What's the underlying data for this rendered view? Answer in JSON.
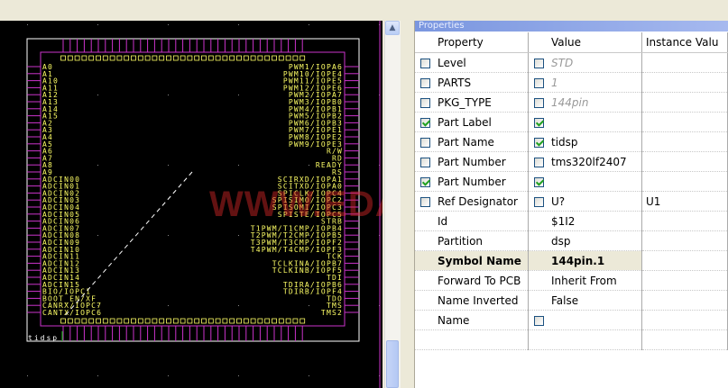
{
  "schematic": {
    "colors": {
      "background": "#000000",
      "border": "#ffffff",
      "body": "#cc33cc",
      "pin": "#cc33cc",
      "label": "#ffff66",
      "watermark": "#dc2828"
    },
    "part_label": "tidsp",
    "watermark": "WWW.EDA365.COM",
    "left_pins": [
      "A0",
      "A1",
      "A10",
      "A11",
      "A12",
      "A13",
      "A14",
      "A15",
      "A2",
      "A3",
      "A4",
      "A5",
      "A6",
      "A7",
      "A8",
      "A9",
      "ADCIN00",
      "ADCIN01",
      "ADCIN02",
      "ADCIN03",
      "ADCIN04",
      "ADCIN05",
      "ADCIN06",
      "ADCIN07",
      "ADCIN08",
      "ADCIN09",
      "ADCIN10",
      "ADCIN11",
      "ADCIN12",
      "ADCIN13",
      "ADCIN14",
      "ADCIN15",
      "BIO/IOPC1",
      "BOOT_EN/XF",
      "CANRX/IOPC7",
      "CANTX/IOPC6"
    ],
    "right_pins": [
      "PWM1/IOPA6",
      "PWM10/IOPE4",
      "PWM11/IOPE5",
      "PWM12/IOPE6",
      "PWM2/IOPA7",
      "PWM3/IOPB0",
      "PWM4/IOPB1",
      "PWM5/IOPB2",
      "PWM6/IOPB3",
      "PWM7/IOPE1",
      "PWM8/IOPE2",
      "PWM9/IOPE3",
      "R/W",
      "RD",
      "READY",
      "RS",
      "SCIRXD/IOPA1",
      "SCITXD/IOPA0",
      "SPICLK/IOPC4",
      "SPISIMO/IOPC2",
      "SPISOMI/IOPC3",
      "SPISTE/IOPC5",
      "STRB",
      "T1PWM/T1CMP/IOPB4",
      "T2PWM/T2CMP/IOPB5",
      "T3PWM/T3CMP/IOPF2",
      "T4PWM/T4CMP/IOPF3",
      "TCK",
      "TCLKINA/IOPB7",
      "TCLKINB/IOPF5",
      "TDI",
      "TDIRA/IOPB6",
      "TDIRB/IOPF4",
      "TDO",
      "TMS",
      "TMS2"
    ]
  },
  "scrollbar": {
    "up_icon": "chevron-up-icon"
  },
  "properties": {
    "title": "Properties",
    "columns": [
      "Property",
      "Value",
      "Instance Valu"
    ],
    "rows": [
      {
        "checkbox": false,
        "name": "Level",
        "value_checkbox": false,
        "value": "STD",
        "gray": true,
        "instance": ""
      },
      {
        "checkbox": false,
        "name": "PARTS",
        "value_checkbox": false,
        "value": "1",
        "gray": true,
        "instance": ""
      },
      {
        "checkbox": false,
        "name": "PKG_TYPE",
        "value_checkbox": false,
        "value": "144pin",
        "gray": true,
        "instance": ""
      },
      {
        "checkbox": true,
        "name": "Part Label",
        "value_checkbox": true,
        "value": "",
        "gray": false,
        "instance": ""
      },
      {
        "checkbox": false,
        "name": "Part Name",
        "value_checkbox": true,
        "value": "tidsp",
        "gray": false,
        "instance": ""
      },
      {
        "checkbox": false,
        "name": "Part Number",
        "value_checkbox": false,
        "value": "tms320lf2407",
        "gray": false,
        "instance": ""
      },
      {
        "checkbox": true,
        "name": "Part Number",
        "value_checkbox": true,
        "value": "",
        "gray": false,
        "instance": ""
      },
      {
        "checkbox": false,
        "name": "Ref Designator",
        "value_checkbox": false,
        "value": "U?",
        "gray": false,
        "instance": "U1"
      },
      {
        "checkbox": null,
        "name": "Id",
        "value_checkbox": null,
        "value": "$1I2",
        "gray": false,
        "instance": ""
      },
      {
        "checkbox": null,
        "name": "Partition",
        "value_checkbox": null,
        "value": "dsp",
        "gray": false,
        "instance": ""
      },
      {
        "checkbox": null,
        "name": "Symbol Name",
        "value_checkbox": null,
        "value": "144pin.1",
        "gray": false,
        "instance": "",
        "selected": true
      },
      {
        "checkbox": null,
        "name": "Forward To PCB",
        "value_checkbox": null,
        "value": "Inherit From",
        "gray": false,
        "instance": ""
      },
      {
        "checkbox": null,
        "name": "Name Inverted",
        "value_checkbox": null,
        "value": "False",
        "gray": false,
        "instance": ""
      },
      {
        "checkbox": null,
        "name": "Name",
        "value_checkbox": false,
        "value": "",
        "gray": false,
        "instance": ""
      }
    ]
  }
}
